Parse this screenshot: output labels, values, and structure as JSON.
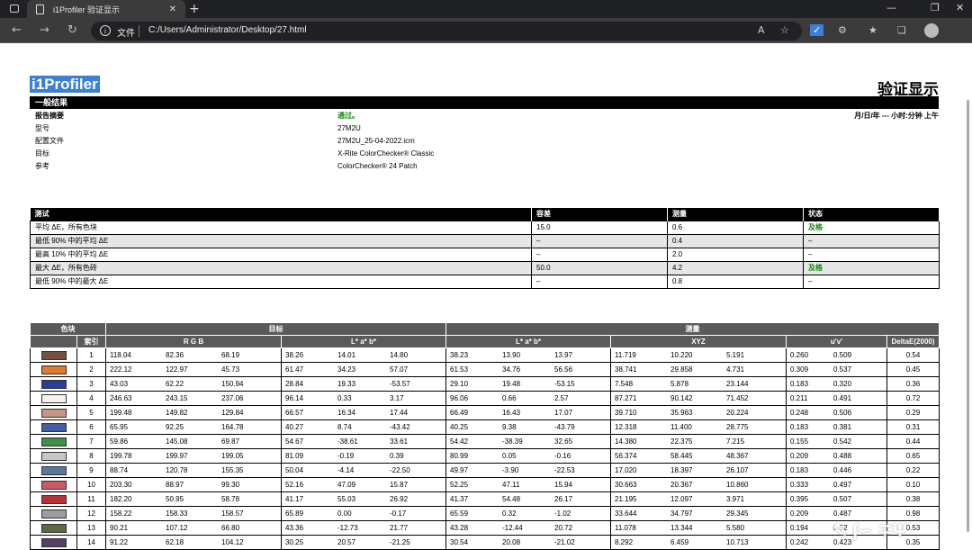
{
  "browser": {
    "tab_title": "i1Profiler 验证显示",
    "address_label": "文件",
    "url": "C:/Users/Administrator/Desktop/27.html"
  },
  "report": {
    "brand": "i1Profiler",
    "title": "验证显示",
    "general_header": "一般结果",
    "summary": [
      {
        "label": "报告摘要",
        "value": "通过。",
        "right": "月/日/年 --- 小时:分钟 上午"
      },
      {
        "label": "型号",
        "value": "27M2U"
      },
      {
        "label": "配置文件",
        "value": "27M2U_25-04-2022.icm"
      },
      {
        "label": "目标",
        "value": "X-Rite ColorChecker® Classic"
      },
      {
        "label": "参考",
        "value": "ColorChecker® 24 Patch"
      }
    ],
    "tests_headers": [
      "测试",
      "容差",
      "测量",
      "状态"
    ],
    "tests": [
      [
        "平均 ΔE，所有色块",
        "15.0",
        "0.6",
        "及格"
      ],
      [
        "最低 90% 中的平均 ΔE",
        "–",
        "0.4",
        "–"
      ],
      [
        "最高 10% 中的平均 ΔE",
        "–",
        "2.0",
        "–"
      ],
      [
        "最大 ΔE，所有色砖",
        "50.0",
        "4.2",
        "及格"
      ],
      [
        "最低 90% 中的最大 ΔE",
        "–",
        "0.8",
        "–"
      ]
    ],
    "patch_headers": {
      "patch": "色块",
      "target": "目标",
      "measured": "测量",
      "index": "索引",
      "rgb": "R G B",
      "lab": "L* a* b*",
      "lab2": "L* a* b*",
      "xyz": "XYZ",
      "uv": "u'v'",
      "de": "DeltaE(2000)"
    },
    "patches": [
      {
        "i": "1",
        "color": "#76503f",
        "rgb": [
          "118.04",
          "82.36",
          "68.19"
        ],
        "tlab": [
          "38.26",
          "14.01",
          "14.80"
        ],
        "mlab": [
          "38.23",
          "13.90",
          "13.97"
        ],
        "xyz": [
          "11.719",
          "10.220",
          "5.191"
        ],
        "uv": [
          "0.260",
          "0.509"
        ],
        "de": "0.54"
      },
      {
        "i": "2",
        "color": "#de7b2e",
        "rgb": [
          "222.12",
          "122.97",
          "45.73"
        ],
        "tlab": [
          "61.47",
          "34.23",
          "57.07"
        ],
        "mlab": [
          "61.53",
          "34.76",
          "56.56"
        ],
        "xyz": [
          "38.741",
          "29.858",
          "4.731"
        ],
        "uv": [
          "0.309",
          "0.537"
        ],
        "de": "0.45"
      },
      {
        "i": "3",
        "color": "#2b3e97",
        "rgb": [
          "43.03",
          "62.22",
          "150.94"
        ],
        "tlab": [
          "28.84",
          "19.33",
          "-53.57"
        ],
        "mlab": [
          "29.10",
          "19.48",
          "-53.15"
        ],
        "xyz": [
          "7.548",
          "5.878",
          "23.144"
        ],
        "uv": [
          "0.183",
          "0.320"
        ],
        "de": "0.36"
      },
      {
        "i": "4",
        "color": "#f6f3ed",
        "rgb": [
          "246.63",
          "243.15",
          "237.06"
        ],
        "tlab": [
          "96.14",
          "0.33",
          "3.17"
        ],
        "mlab": [
          "96.06",
          "0.66",
          "2.57"
        ],
        "xyz": [
          "87.271",
          "90.142",
          "71.452"
        ],
        "uv": [
          "0.211",
          "0.491"
        ],
        "de": "0.72"
      },
      {
        "i": "5",
        "color": "#c79582",
        "rgb": [
          "199.48",
          "149.82",
          "129.84"
        ],
        "tlab": [
          "66.57",
          "16.34",
          "17.44"
        ],
        "mlab": [
          "66.49",
          "16.43",
          "17.07"
        ],
        "xyz": [
          "39.710",
          "35.963",
          "20.224"
        ],
        "uv": [
          "0.248",
          "0.506"
        ],
        "de": "0.29"
      },
      {
        "i": "6",
        "color": "#425ca5",
        "rgb": [
          "65.95",
          "92.25",
          "164.78"
        ],
        "tlab": [
          "40.27",
          "8.74",
          "-43.42"
        ],
        "mlab": [
          "40.25",
          "9.38",
          "-43.79"
        ],
        "xyz": [
          "12.318",
          "11.400",
          "28.775"
        ],
        "uv": [
          "0.183",
          "0.381"
        ],
        "de": "0.31"
      },
      {
        "i": "7",
        "color": "#3b9145",
        "rgb": [
          "59.86",
          "145.08",
          "69.87"
        ],
        "tlab": [
          "54.67",
          "-38.61",
          "33.61"
        ],
        "mlab": [
          "54.42",
          "-38.39",
          "32.65"
        ],
        "xyz": [
          "14.380",
          "22.375",
          "7.215"
        ],
        "uv": [
          "0.155",
          "0.542"
        ],
        "de": "0.44"
      },
      {
        "i": "8",
        "color": "#c7c7c7",
        "rgb": [
          "199.78",
          "199.97",
          "199.05"
        ],
        "tlab": [
          "81.09",
          "-0.19",
          "0.39"
        ],
        "mlab": [
          "80.99",
          "0.05",
          "-0.16"
        ],
        "xyz": [
          "56.374",
          "58.445",
          "48.367"
        ],
        "uv": [
          "0.209",
          "0.488"
        ],
        "de": "0.65"
      },
      {
        "i": "9",
        "color": "#58799b",
        "rgb": [
          "88.74",
          "120.78",
          "155.35"
        ],
        "tlab": [
          "50.04",
          "-4.14",
          "-22.50"
        ],
        "mlab": [
          "49.97",
          "-3.90",
          "-22.53"
        ],
        "xyz": [
          "17.020",
          "18.397",
          "26.107"
        ],
        "uv": [
          "0.183",
          "0.446"
        ],
        "de": "0.22"
      },
      {
        "i": "10",
        "color": "#cb5963",
        "rgb": [
          "203.30",
          "88.97",
          "99.30"
        ],
        "tlab": [
          "52.16",
          "47.09",
          "15.87"
        ],
        "mlab": [
          "52.25",
          "47.11",
          "15.94"
        ],
        "xyz": [
          "30.663",
          "20.367",
          "10.860"
        ],
        "uv": [
          "0.333",
          "0.497"
        ],
        "de": "0.10"
      },
      {
        "i": "11",
        "color": "#b6333b",
        "rgb": [
          "182.20",
          "50.95",
          "58.78"
        ],
        "tlab": [
          "41.17",
          "55.03",
          "26.92"
        ],
        "mlab": [
          "41.37",
          "54.48",
          "26.17"
        ],
        "xyz": [
          "21.195",
          "12.097",
          "3.971"
        ],
        "uv": [
          "0.395",
          "0.507"
        ],
        "de": "0.38"
      },
      {
        "i": "12",
        "color": "#9e9e9f",
        "rgb": [
          "158.22",
          "158.33",
          "158.57"
        ],
        "tlab": [
          "65.89",
          "0.00",
          "-0.17"
        ],
        "mlab": [
          "65.59",
          "0.32",
          "-1.02"
        ],
        "xyz": [
          "33.644",
          "34.797",
          "29.345"
        ],
        "uv": [
          "0.209",
          "0.487"
        ],
        "de": "0.98"
      },
      {
        "i": "13",
        "color": "#5a6b43",
        "rgb": [
          "90.21",
          "107.12",
          "66.80"
        ],
        "tlab": [
          "43.36",
          "-12.73",
          "21.77"
        ],
        "mlab": [
          "43.28",
          "-12.44",
          "20.72"
        ],
        "xyz": [
          "11.078",
          "13.344",
          "5.580"
        ],
        "uv": [
          "0.194",
          "0.52"
        ],
        "de": "0.53"
      },
      {
        "i": "14",
        "color": "#5b3e68",
        "rgb": [
          "91.22",
          "62.18",
          "104.12"
        ],
        "tlab": [
          "30.25",
          "20.57",
          "-21.25"
        ],
        "mlab": [
          "30.54",
          "20.08",
          "-21.02"
        ],
        "xyz": [
          "8.292",
          "6.459",
          "10.713"
        ],
        "uv": [
          "0.242",
          "0.423"
        ],
        "de": "0.35"
      }
    ]
  }
}
